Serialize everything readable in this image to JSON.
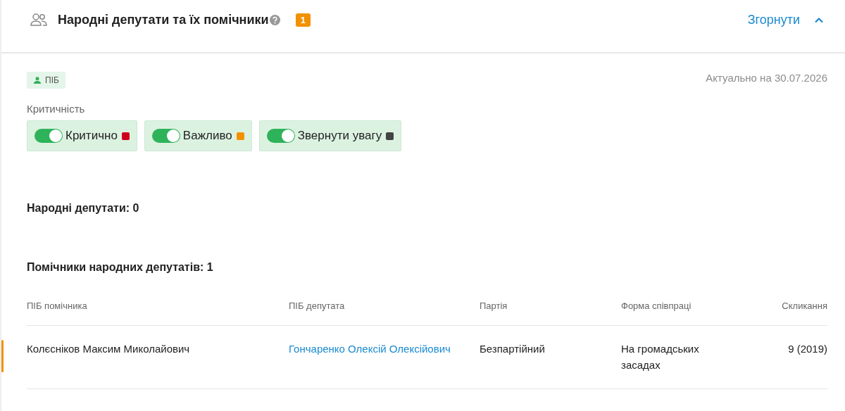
{
  "header": {
    "title": "Народні депутати та їх помічники",
    "badge": "1",
    "collapse_label": "Згорнути"
  },
  "filter_tag": "ПІБ",
  "updated": "Актуально на 30.07.2026",
  "criticality": {
    "label": "Критичність",
    "toggles": [
      {
        "label": "Критично",
        "on": true,
        "color": "#d0021b"
      },
      {
        "label": "Важливо",
        "on": true,
        "color": "#f29100"
      },
      {
        "label": "Звернути увагу",
        "on": true,
        "color": "#444444"
      }
    ]
  },
  "deputies_heading": "Народні депутати: 0",
  "assistants_heading": "Помічники народних депутатів: 1",
  "table": {
    "columns": [
      "ПІБ помічника",
      "ПІБ депутата",
      "Партія",
      "Форма співпраці",
      "Скликання"
    ],
    "rows": [
      {
        "color": "#f29100",
        "cells": [
          "Колєсніков Максим Миколайович",
          "Гончаренко Олексій Олексійович",
          "Безпартійний",
          "На громадських засадах",
          "9 (2019)"
        ]
      }
    ]
  }
}
